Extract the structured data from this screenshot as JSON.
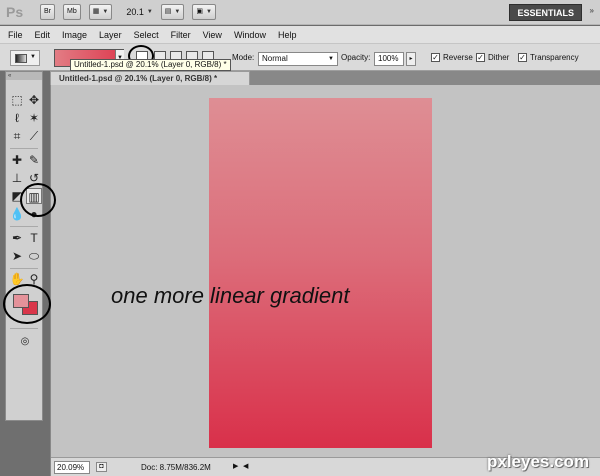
{
  "appbar": {
    "logo": "Ps",
    "bridge_label": "Br",
    "minibridge_label": "Mb",
    "zoom_level": "20.1",
    "workspace_button": "ESSENTIALS",
    "more_label": "»"
  },
  "menu": [
    "File",
    "Edit",
    "Image",
    "Layer",
    "Select",
    "Filter",
    "View",
    "Window",
    "Help"
  ],
  "options": {
    "mode_label": "Mode:",
    "mode_value": "Normal",
    "opacity_label": "Opacity:",
    "opacity_value": "100%",
    "reverse_label": "Reverse",
    "dither_label": "Dither",
    "transparency_label": "Transparency",
    "reverse_checked": true,
    "dither_checked": true,
    "transparency_checked": true
  },
  "tooltip": "Untitled-1.psd @ 20.1% (Layer 0, RGB/8) *",
  "document_tab": "Untitled-1.psd @ 20.1% (Layer 0, RGB/8) *",
  "caption": "one more linear gradient",
  "colors": {
    "foreground": "#e4929a",
    "background": "#d9364a",
    "gradient_top": "#de8e94",
    "gradient_bottom": "#d9304a"
  },
  "status": {
    "zoom": "20.09%",
    "doc_size": "Doc: 8.75M/836.2M"
  },
  "watermark": "pxleyes.com"
}
